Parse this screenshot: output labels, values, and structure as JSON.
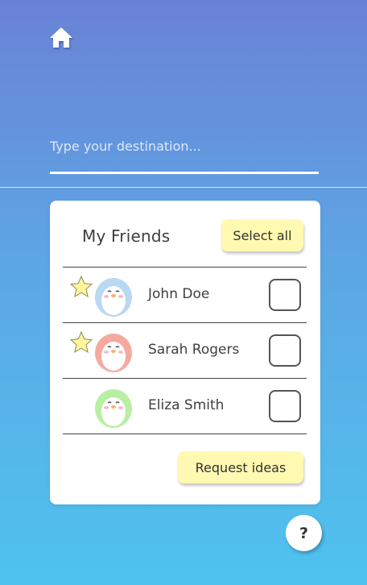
{
  "header": {
    "home_icon": "home-icon"
  },
  "destination": {
    "placeholder": "Type your destination...",
    "value": ""
  },
  "friends_card": {
    "title": "My Friends",
    "select_all_label": "Select all",
    "friends": [
      {
        "name": "John Doe",
        "starred": true,
        "avatar_color": "#b9d8f2",
        "checked": false
      },
      {
        "name": "Sarah Rogers",
        "starred": true,
        "avatar_color": "#f5aaa0",
        "checked": false
      },
      {
        "name": "Eliza Smith",
        "starred": false,
        "avatar_color": "#b9efa3",
        "checked": false
      }
    ],
    "request_label": "Request ideas"
  },
  "help": {
    "label": "?"
  },
  "colors": {
    "gradient_top": "#6a82d6",
    "gradient_bottom": "#4fc3ef",
    "button_yellow": "#fff9b1",
    "star_yellow": "#fff59d"
  }
}
